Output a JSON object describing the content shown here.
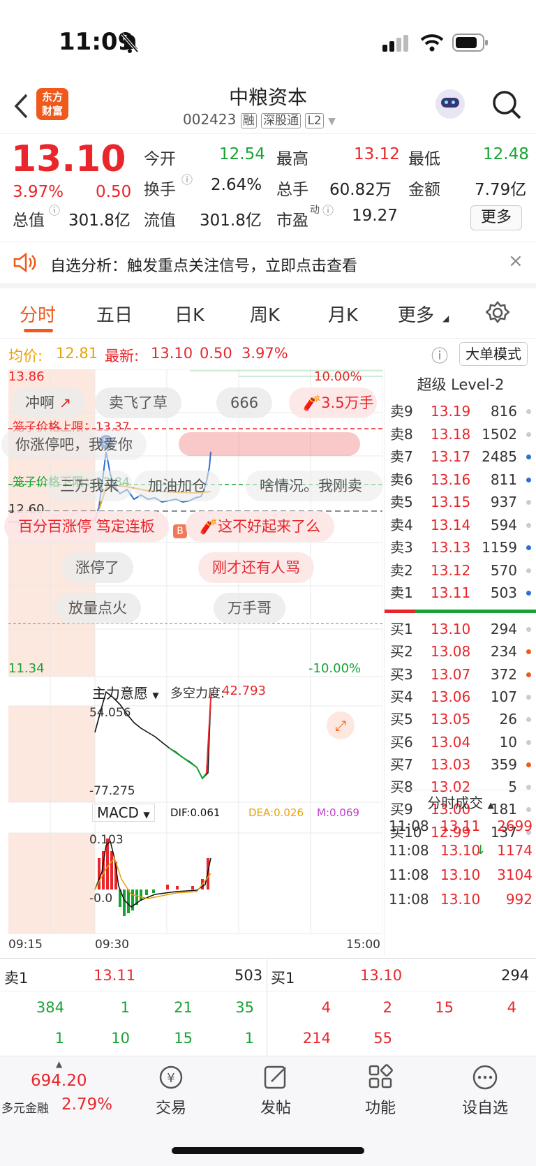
{
  "status": {
    "time": "11:09"
  },
  "header": {
    "logo_line1": "东方",
    "logo_line2": "财富",
    "title": "中粮资本",
    "code": "002423",
    "tags": [
      "融",
      "深股通",
      "L2"
    ]
  },
  "quote": {
    "price": "13.10",
    "pct": "3.97%",
    "change": "0.50",
    "open_l": "今开",
    "open_v": "12.54",
    "high_l": "最高",
    "high_v": "13.12",
    "low_l": "最低",
    "low_v": "12.48",
    "turn_l": "换手",
    "turn_v": "2.64%",
    "vol_l": "总手",
    "vol_v": "60.82万",
    "amt_l": "金额",
    "amt_v": "7.79亿",
    "mcap_l": "总值",
    "mcap_v": "301.8亿",
    "fcap_l": "流值",
    "fcap_v": "301.8亿",
    "pe_l": "市盈",
    "pe_sup": "动",
    "pe_v": "19.27",
    "more": "更多"
  },
  "notice": {
    "text": "自选分析：触发重点关注信号，立即点击查看"
  },
  "tabs": [
    "分时",
    "五日",
    "日K",
    "周K",
    "月K",
    "更多"
  ],
  "infoline": {
    "avg_l": "均价:",
    "avg_v": "12.81",
    "last_l": "最新:",
    "last_v": "13.10",
    "chg": "0.50",
    "pct": "3.97%",
    "mode": "大单模式"
  },
  "chart": {
    "top": "13.86",
    "bottom": "11.34",
    "top_pct": "10.00%",
    "bottom_pct": "-10.00%",
    "mid": "12.60",
    "upper_label": "笼子价格上限：13.37",
    "lower_label": "笼子价格下限：12.84",
    "marker_s": "S",
    "marker_b": "B",
    "bubbles": [
      "冲啊",
      "卖飞了草",
      "666",
      "3.5万手",
      "你涨停吧，我爱你",
      "三万我来",
      "加油加仓",
      "啥情况。我刚卖",
      "百分百涨停 笃定连板",
      "这不好起来了么",
      "涨停了",
      "刚才还有人骂",
      "放量点火",
      "万手哥"
    ],
    "ind1_name": "主力意愿",
    "ind1_extra_l": "多空力度:",
    "ind1_extra_v": "42.793",
    "ind1_top": "54.056",
    "ind1_bottom": "-77.275",
    "macd_name": "MACD",
    "dif": "DIF:0.061",
    "dea": "DEA:0.026",
    "m": "M:0.069",
    "macd_top": "0.103",
    "macd_bottom": "-0.0",
    "t_start": "09:15",
    "t_open": "09:30",
    "t_end": "15:00"
  },
  "orderbook": {
    "title": "超级 Level-2",
    "asks": [
      [
        "卖9",
        "13.19",
        "816"
      ],
      [
        "卖8",
        "13.18",
        "1502"
      ],
      [
        "卖7",
        "13.17",
        "2485"
      ],
      [
        "卖6",
        "13.16",
        "811"
      ],
      [
        "卖5",
        "13.15",
        "937"
      ],
      [
        "卖4",
        "13.14",
        "594"
      ],
      [
        "卖3",
        "13.13",
        "1159"
      ],
      [
        "卖2",
        "13.12",
        "570"
      ],
      [
        "卖1",
        "13.11",
        "503"
      ]
    ],
    "bids": [
      [
        "买1",
        "13.10",
        "294"
      ],
      [
        "买2",
        "13.08",
        "234"
      ],
      [
        "买3",
        "13.07",
        "372"
      ],
      [
        "买4",
        "13.06",
        "107"
      ],
      [
        "买5",
        "13.05",
        "26"
      ],
      [
        "买6",
        "13.04",
        "10"
      ],
      [
        "买7",
        "13.03",
        "359"
      ],
      [
        "买8",
        "13.02",
        "5"
      ],
      [
        "买9",
        "13.00",
        "181"
      ],
      [
        "买10",
        "12.99",
        "137"
      ]
    ],
    "ticks_title": "分时成交",
    "ticks": [
      [
        "11:08",
        "13.11",
        "2699"
      ],
      [
        "11:08",
        "13.10",
        "1174"
      ],
      [
        "11:08",
        "13.10",
        "3104"
      ],
      [
        "11:08",
        "13.10",
        "992"
      ]
    ]
  },
  "bottom": {
    "ask_l": "卖1",
    "ask_p": "13.11",
    "ask_v": "503",
    "bid_l": "买1",
    "bid_p": "13.10",
    "bid_v": "294",
    "ask_q1": [
      "384",
      "1",
      "21",
      "35"
    ],
    "ask_q2": [
      "1",
      "10",
      "15",
      "1"
    ],
    "bid_q1": [
      "4",
      "2",
      "15",
      "4"
    ],
    "bid_q2": [
      "214",
      "55"
    ]
  },
  "nav": {
    "index_v": "694.20",
    "index_name": "多元金融",
    "index_pct": "2.79%",
    "items": [
      "交易",
      "发帖",
      "功能",
      "设自选"
    ]
  }
}
